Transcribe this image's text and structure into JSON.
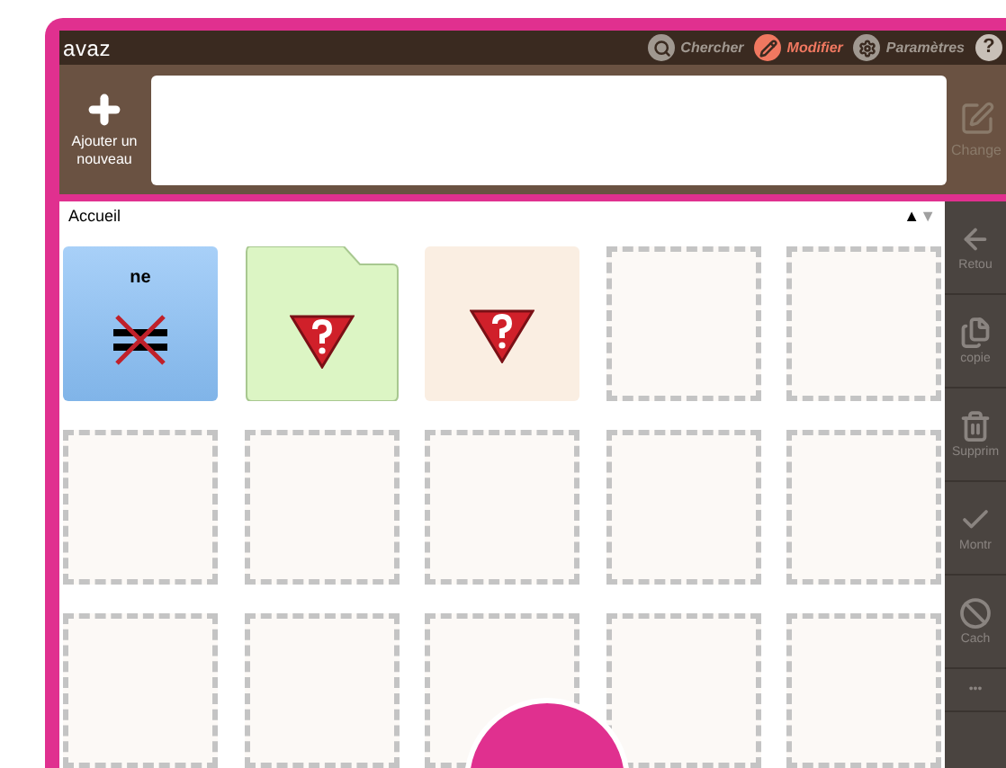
{
  "app": {
    "logo": "avaz"
  },
  "toolbar": [
    {
      "label": "Chercher",
      "selected": false
    },
    {
      "label": "Modifier",
      "selected": true
    },
    {
      "label": "Paramètres",
      "selected": false
    }
  ],
  "help": {
    "glyph": "?"
  },
  "add_button": {
    "label": "Ajouter un nouveau"
  },
  "change_button": {
    "label": "Change"
  },
  "breadcrumb": {
    "label": "Accueil"
  },
  "sort_arrows": [
    "▲",
    "▼"
  ],
  "tiles": [
    {
      "kind": "word",
      "label": "ne"
    },
    {
      "kind": "folder"
    },
    {
      "kind": "blank"
    },
    {
      "kind": "empty"
    },
    {
      "kind": "empty"
    },
    {
      "kind": "empty"
    },
    {
      "kind": "empty"
    },
    {
      "kind": "empty"
    },
    {
      "kind": "empty"
    },
    {
      "kind": "empty"
    },
    {
      "kind": "empty"
    },
    {
      "kind": "empty"
    },
    {
      "kind": "empty"
    },
    {
      "kind": "empty"
    },
    {
      "kind": "empty"
    }
  ],
  "sidebar": [
    {
      "label": "Retou"
    },
    {
      "label": "copie"
    },
    {
      "label": "Supprim"
    },
    {
      "label": "Montr"
    },
    {
      "label": "Cach"
    },
    {
      "label": "•••"
    }
  ]
}
